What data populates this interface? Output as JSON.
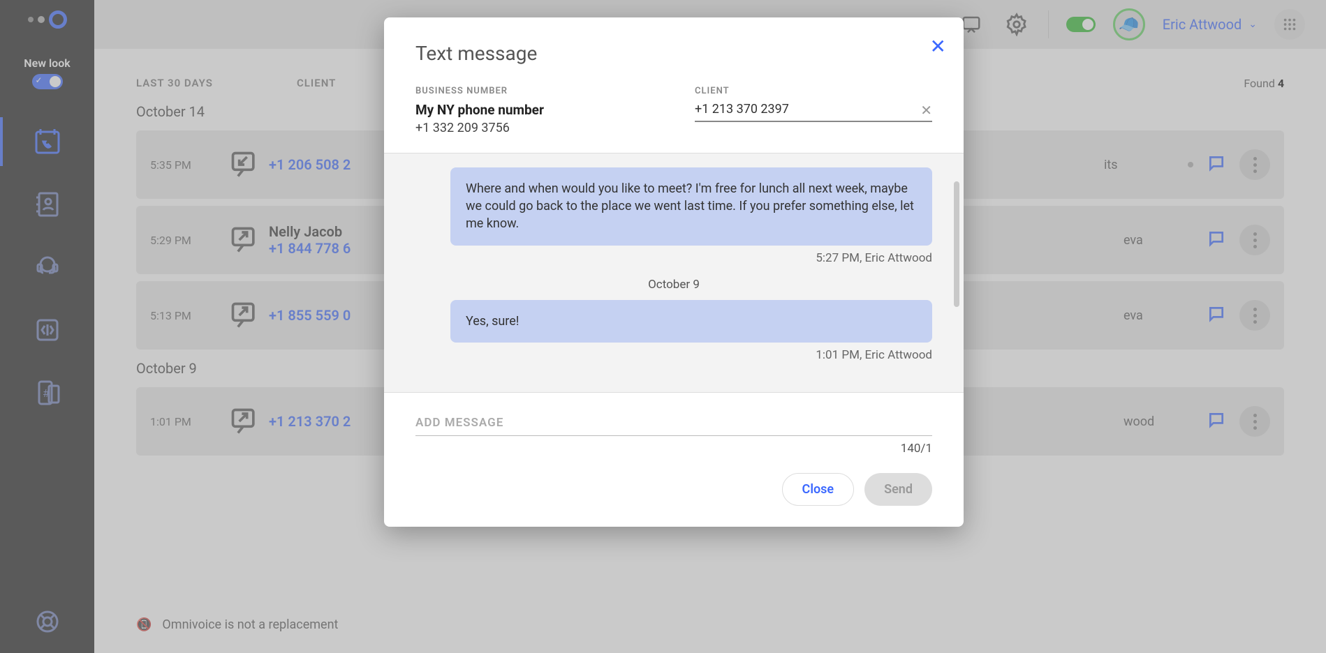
{
  "sidebar": {
    "newlook_label": "New look"
  },
  "header": {
    "username": "Eric Attwood"
  },
  "list": {
    "col_date": "LAST 30 DAYS",
    "col_client": "CLIENT",
    "found_label": "Found",
    "found_count": "4",
    "days": [
      {
        "label": "October 14",
        "rows": [
          {
            "time": "5:35 PM",
            "dir": "in",
            "name": "",
            "phone": "+1 206 508 2",
            "agent": "its",
            "dot": true
          },
          {
            "time": "5:29 PM",
            "dir": "out",
            "name": "Nelly Jacob",
            "phone": "+1 844 778 6",
            "agent": "eva",
            "dot": false
          },
          {
            "time": "5:13 PM",
            "dir": "out",
            "name": "",
            "phone": "+1 855 559 0",
            "agent": "eva",
            "dot": false
          }
        ]
      },
      {
        "label": "October 9",
        "rows": [
          {
            "time": "1:01 PM",
            "dir": "out",
            "name": "",
            "phone": "+1 213 370 2",
            "agent": "wood",
            "dot": false
          }
        ]
      }
    ],
    "footer": "Omnivoice is not a replacement"
  },
  "modal": {
    "title": "Text message",
    "biz_label": "BUSINESS NUMBER",
    "biz_name": "My NY phone number",
    "biz_num": "+1 332 209 3756",
    "client_label": "CLIENT",
    "client_value": "+1 213 370 2397",
    "messages": [
      {
        "text": "Where and when would you like to meet? I'm free for lunch all next week, maybe we could go back to the place we went last time. If you prefer something else, let me know.",
        "meta": "5:27 PM, Eric Attwood"
      }
    ],
    "day2": "October 9",
    "messages2": [
      {
        "text": "Yes, sure!",
        "meta": "1:01 PM, Eric Attwood"
      }
    ],
    "add_placeholder": "ADD MESSAGE",
    "counter": "140/1",
    "close_label": "Close",
    "send_label": "Send"
  }
}
